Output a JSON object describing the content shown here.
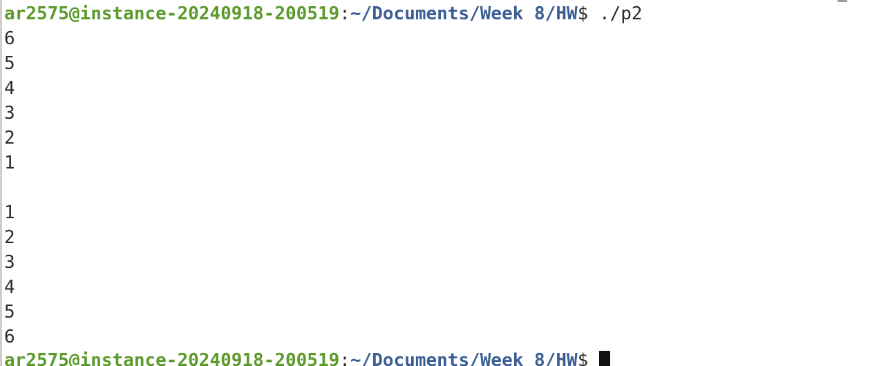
{
  "prompt": {
    "user_host": "ar2575@instance-20240918-200519",
    "separator": ":",
    "path": "~/Documents/Week 8/HW",
    "symbol": "$",
    "command": " ./p2"
  },
  "output": {
    "descending": [
      "6",
      "5",
      "4",
      "3",
      "2",
      "1"
    ],
    "blank": "",
    "ascending": [
      "1",
      "2",
      "3",
      "4",
      "5",
      "6"
    ]
  },
  "prompt_final": {
    "user_host": "ar2575@instance-20240918-200519",
    "separator": ":",
    "path": "~/Documents/Week 8/HW",
    "symbol": "$ "
  }
}
